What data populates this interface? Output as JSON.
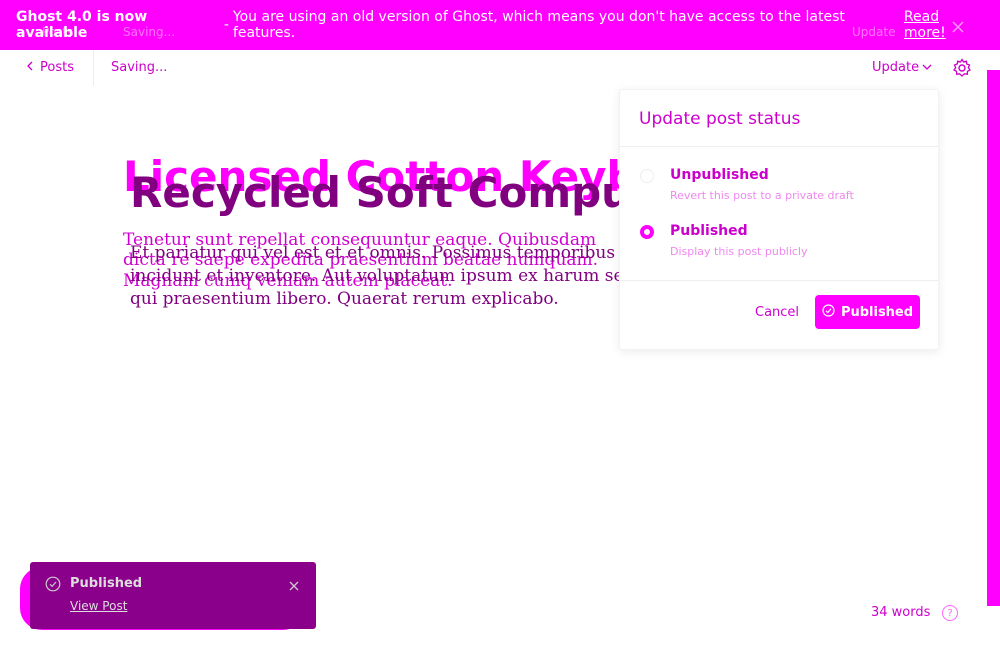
{
  "banner": {
    "title": "Ghost 4.0 is now available",
    "separator": "-",
    "message": "You are using an old version of Ghost, which means you don't have access to the latest features.",
    "link": "Read more!",
    "ghost_posts": "Posts",
    "ghost_saving": "Saving...",
    "ghost_update": "Update",
    "close_icon": "close-icon"
  },
  "topbar": {
    "back_label": "Posts",
    "status": "Saving...",
    "update_label": "Update",
    "settings_icon": "gear-icon"
  },
  "editor": {
    "ghost_title": "Licensed Cotton Keyb",
    "title": "Recycled Soft Computer",
    "ghost_body": "Tenetur sunt repellat consequuntur eaque. Quibusdam dicta re saepe expedita praesentium beatae numquam. Magnam cumq veniam autem placeat.",
    "body": "Et pariatur qui vel est et et omnis. Possimus temporibus et dignissimos qui quo et incidunt et inventore. Aut voluptatum ipsum ex harum sed blanditiis. Earum at totam qui praesentium libero. Quaerat rerum explicabo."
  },
  "dropdown": {
    "header": "Update post status",
    "options": [
      {
        "label": "Unpublished",
        "description": "Revert this post to a private draft",
        "selected": false
      },
      {
        "label": "Published",
        "description": "Display this post publicly",
        "selected": true
      }
    ],
    "cancel_label": "Cancel",
    "confirm_label": "Published"
  },
  "toast": {
    "title": "Published",
    "link": "View Post"
  },
  "footer": {
    "word_count": "34 words",
    "help": "?"
  },
  "colors": {
    "accent": "#ff00ff",
    "text_dark": "#800080",
    "toast_bg": "#8b008b"
  }
}
